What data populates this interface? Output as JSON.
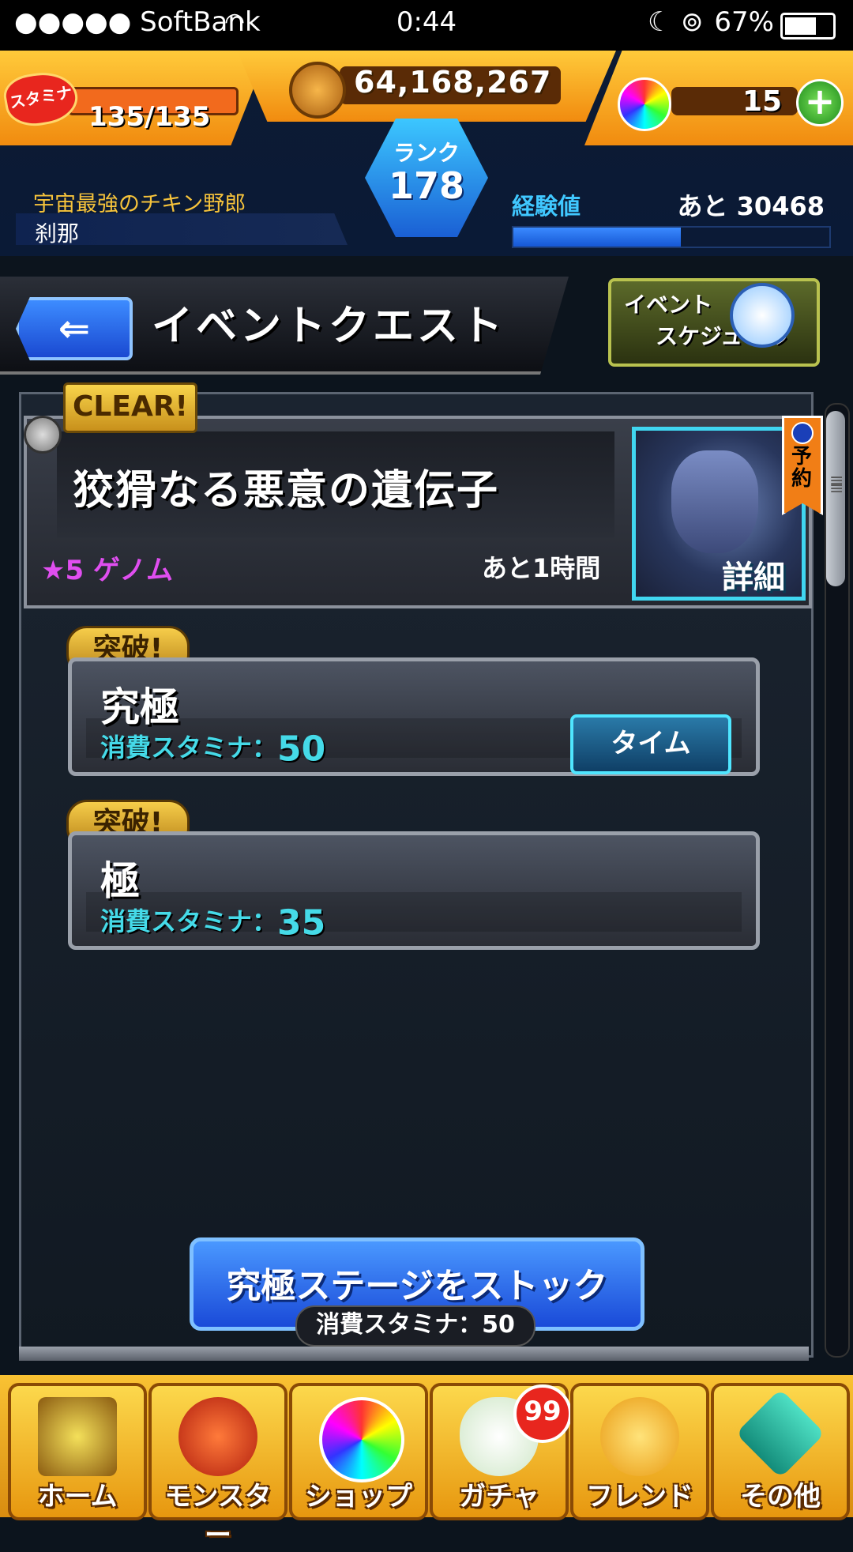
{
  "status_bar": {
    "carrier": "●●●●● SoftBank",
    "wifi_icon": "wifi-icon",
    "time": "0:44",
    "moon_icon": "moon-icon",
    "lock_icon": "rotation-lock-icon",
    "battery": "67%",
    "battery_level": 0.67
  },
  "hud": {
    "stamina_label": "スタミナ",
    "stamina": "135/135",
    "stamina_fill": 1.0,
    "coins": "64,168,267",
    "orbs": "15",
    "orb_plus": "+",
    "player_title": "宇宙最強のチキン野郎",
    "player_name": "刹那",
    "rank_label": "ランク",
    "rank": "178",
    "exp_label": "経験値",
    "exp_remaining": "あと 30468",
    "exp_fill": 0.53
  },
  "header": {
    "back_arrow": "⇐",
    "title": "イベントクエスト",
    "schedule_line1": "イベント",
    "schedule_line2": "スケジュール"
  },
  "event": {
    "clear_badge": "CLEAR!",
    "title": "狡猾なる悪意の遺伝子",
    "difficulty": "★5 ゲノム",
    "time_remaining": "あと1時間",
    "detail_label": "詳細",
    "reserve_label": "予約"
  },
  "stages": [
    {
      "badge": "突破!",
      "name": "究極",
      "cost_label": "消費スタミナ：",
      "cost": "50"
    },
    {
      "badge": "突破!",
      "name": "極",
      "cost_label": "消費スタミナ：",
      "cost": "35"
    }
  ],
  "time_button": "タイム",
  "stock": {
    "label": "究極ステージをストック",
    "cost": "消費スタミナ：50"
  },
  "tabs": [
    {
      "label": "ホーム",
      "icon": "home-icon"
    },
    {
      "label": "モンスター",
      "icon": "monster-icon"
    },
    {
      "label": "ショップ",
      "icon": "orb-icon"
    },
    {
      "label": "ガチャ",
      "icon": "egg-icon",
      "badge": "99"
    },
    {
      "label": "フレンド",
      "icon": "friends-icon"
    },
    {
      "label": "その他",
      "icon": "question-icon"
    }
  ],
  "colors": {
    "gold": "#f49a0f",
    "blue_accent": "#1a4ad8",
    "cyan_text": "#45dae8",
    "purple_text": "#e04ef0"
  }
}
